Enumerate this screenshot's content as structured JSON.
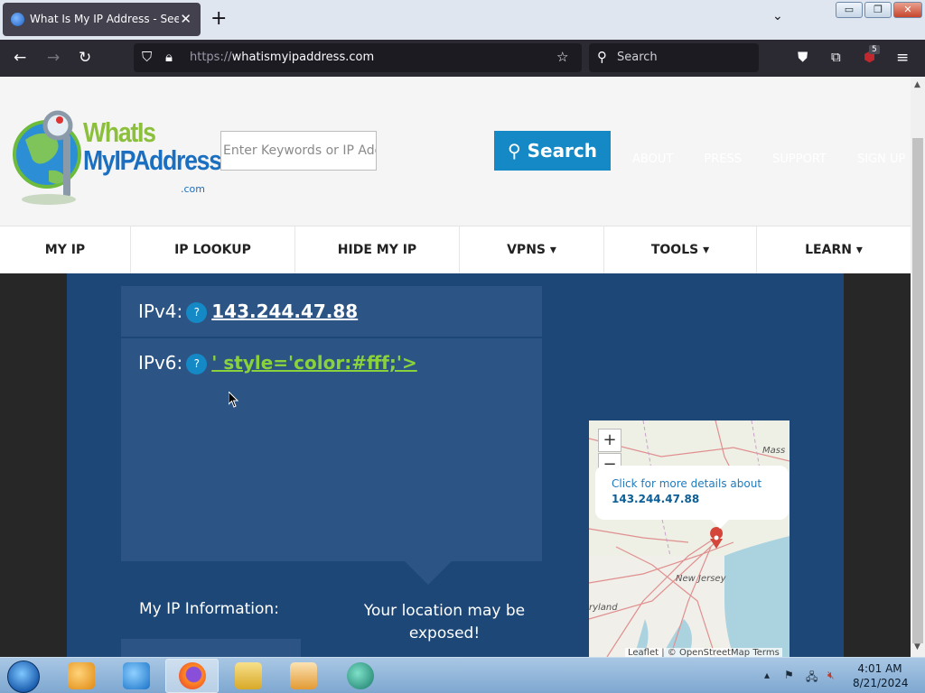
{
  "browser": {
    "tab_title": "What Is My IP Address - See Your",
    "tab_close": "✕",
    "new_tab": "+",
    "tab_list": "⌄",
    "url_scheme": "https://",
    "url_host": "whatismyipaddress.com",
    "search_placeholder": "Search",
    "extension_badge": "5"
  },
  "window_controls": {
    "minimize": "▭",
    "maximize": "❐",
    "close": "✕"
  },
  "site": {
    "logo_line1": "WhatIs",
    "logo_line2": "MyIPAddress",
    "logo_suffix": ".com",
    "search_input_placeholder": "Enter Keywords or IP Address",
    "search_button": "Search",
    "top_links": [
      "ABOUT",
      "PRESS",
      "SUPPORT",
      "SIGN UP"
    ],
    "nav": [
      {
        "label": "MY IP"
      },
      {
        "label": "IP LOOKUP"
      },
      {
        "label": "HIDE MY IP"
      },
      {
        "label": "VPNS ▾"
      },
      {
        "label": "TOOLS ▾"
      },
      {
        "label": "LEARN ▾"
      }
    ]
  },
  "ip_info": {
    "ipv4_label": "IPv4:",
    "ipv4_value": "143.244.47.88",
    "ipv6_label": "IPv6:",
    "ipv6_value": "' style='color:#fff;'>",
    "help": "?",
    "my_ip_information": "My IP Information:",
    "location_warning": "Your location may be exposed!"
  },
  "map": {
    "zoom_in": "+",
    "zoom_out": "−",
    "popup_text": "Click for more details about",
    "popup_ip": "143.244.47.88",
    "label_mass": "Mass",
    "label_nj": "New Jersey",
    "label_md": "ryland",
    "attribution": "Leaflet | © OpenStreetMap Terms"
  },
  "taskbar": {
    "time": "4:01 AM",
    "date": "8/21/2024"
  }
}
